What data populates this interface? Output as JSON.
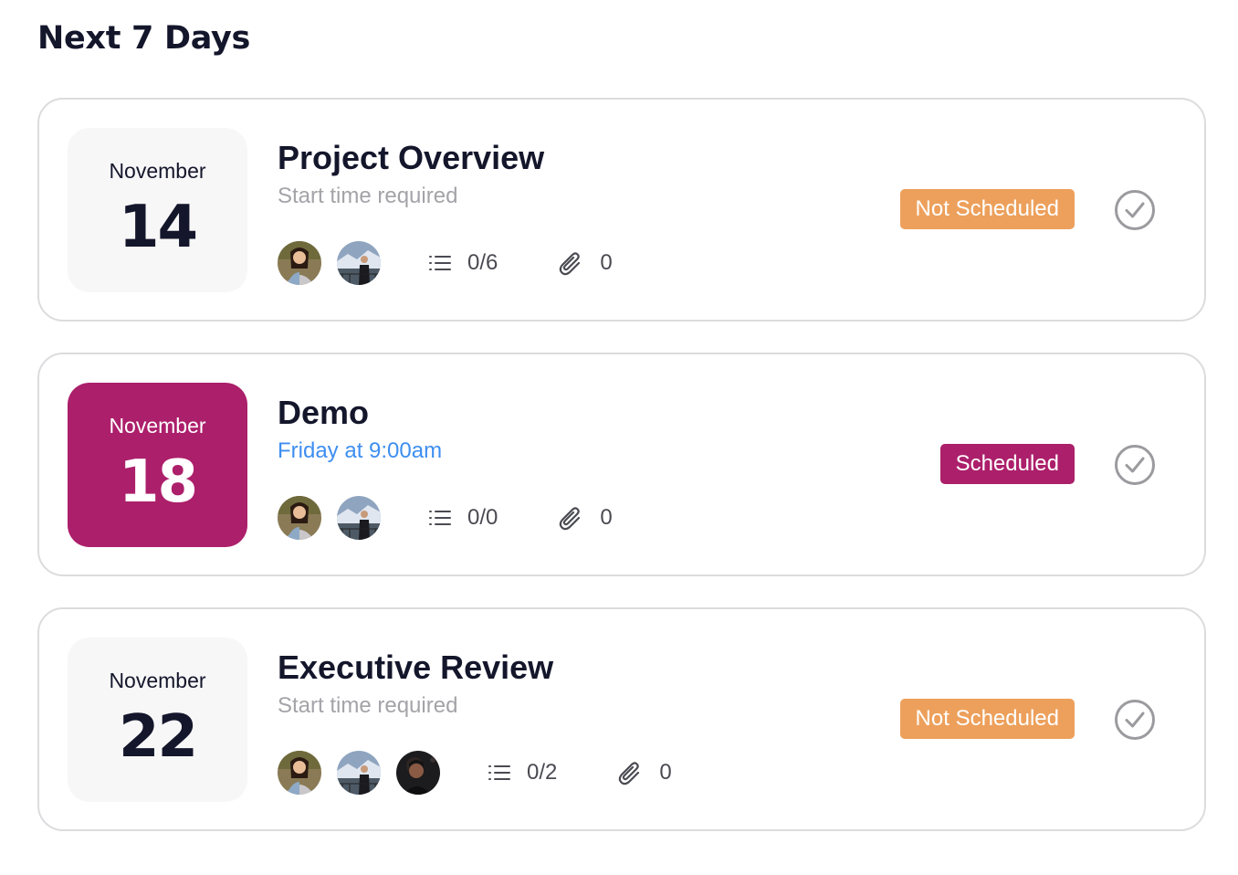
{
  "page": {
    "title": "Next 7 Days"
  },
  "events": [
    {
      "month": "November",
      "day": "14",
      "title": "Project Overview",
      "subtitle": "Start time required",
      "checklist": "0/6",
      "attachments": "0",
      "status": "Not Scheduled",
      "status_color": "#eda05b"
    },
    {
      "month": "November",
      "day": "18",
      "title": "Demo",
      "subtitle": "Friday at 9:00am",
      "checklist": "0/0",
      "attachments": "0",
      "status": "Scheduled",
      "status_color": "#ac1f6b"
    },
    {
      "month": "November",
      "day": "22",
      "title": "Executive Review",
      "subtitle": "Start time required",
      "checklist": "0/2",
      "attachments": "0",
      "status": "Not Scheduled",
      "status_color": "#eda05b"
    }
  ],
  "icons": {
    "checklist": "checklist-icon",
    "attachment": "paperclip-icon",
    "complete": "check-circle-icon"
  },
  "colors": {
    "highlight_date": "#ac1f6b",
    "scheduled_time": "#3e8ef0",
    "text_dark": "#14162b",
    "text_muted": "#a3a3a8"
  }
}
